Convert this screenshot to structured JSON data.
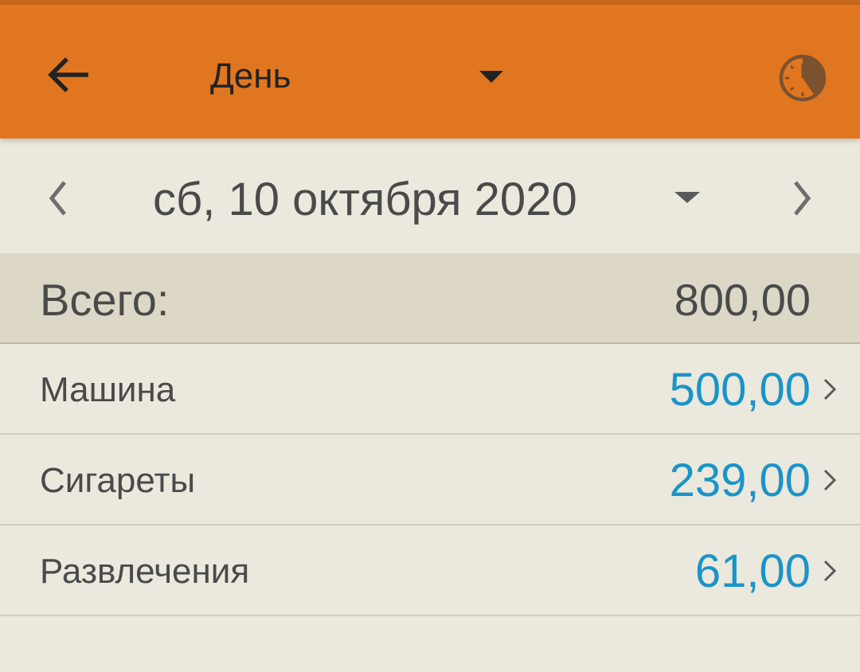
{
  "toolbar": {
    "back_icon": "arrow-left-icon",
    "period_label": "День",
    "period_dropdown_icon": "caret-down-icon",
    "clock_icon": "clock-icon",
    "background_color": "#e0761f"
  },
  "date_nav": {
    "prev_icon": "chevron-left-icon",
    "date_label": "сб, 10 октября 2020",
    "date_dropdown_icon": "caret-down-icon",
    "next_icon": "chevron-right-icon"
  },
  "summary": {
    "label": "Всего:",
    "value": "800,00"
  },
  "categories": [
    {
      "label": "Машина",
      "value": "500,00"
    },
    {
      "label": "Сигареты",
      "value": "239,00"
    },
    {
      "label": "Развлечения",
      "value": "61,00"
    }
  ],
  "colors": {
    "accent": "#e0761f",
    "amount": "#1a94c8",
    "background": "#ebe8dd",
    "summary_background": "#dcd7c6"
  }
}
